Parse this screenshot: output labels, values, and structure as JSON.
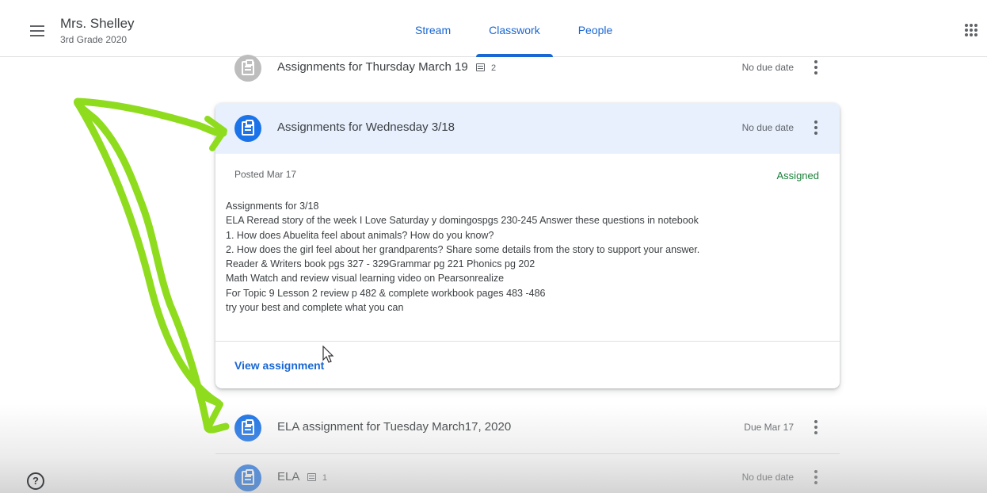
{
  "header": {
    "class_name": "Mrs. Shelley",
    "class_section": "3rd Grade 2020",
    "tabs": [
      {
        "label": "Stream",
        "active": false
      },
      {
        "label": "Classwork",
        "active": true
      },
      {
        "label": "People",
        "active": false
      }
    ]
  },
  "items": [
    {
      "title": "Assignments for Thursday March 19",
      "comments": "2",
      "due": "No due date",
      "icon_color": "#bdbdbd"
    },
    {
      "title": "Assignments for Wednesday 3/18",
      "due": "No due date",
      "icon_color": "#1a73e8"
    },
    {
      "title": "ELA assignment for Tuesday March17, 2020",
      "due": "Due Mar 17",
      "icon_color": "#1a73e8"
    },
    {
      "title": "ELA",
      "comments": "1",
      "due": "No due date",
      "icon_color": "#1a73e8"
    }
  ],
  "expanded": {
    "posted": "Posted Mar 17",
    "status": "Assigned",
    "description_lines": [
      "Assignments  for 3/18",
      "ELA Reread story of the week I Love Saturday y domingospgs 230-245 Answer these questions in notebook",
      "1. How does Abuelita feel about animals? How do you know?",
      "2. How does the girl feel about her grandparents? Share some details from the story to support your answer.",
      "Reader & Writers book pgs 327 - 329Grammar pg 221    Phonics pg 202",
      "Math Watch and review visual learning video on Pearsonrealize",
      "For Topic 9 Lesson 2 review p 482 & complete workbook pages 483 -486",
      "try your best and complete what you can"
    ],
    "view_link": "View assignment"
  },
  "colors": {
    "accent": "#1967d2",
    "assigned": "#188038",
    "annotation": "#8fdc1e",
    "expanded_header": "#e8f0fe"
  },
  "icons": {
    "menu": "hamburger-menu-icon",
    "apps": "google-apps-icon",
    "help": "help-icon",
    "assignment": "assignment-clipboard-icon",
    "more": "more-vert-icon"
  }
}
